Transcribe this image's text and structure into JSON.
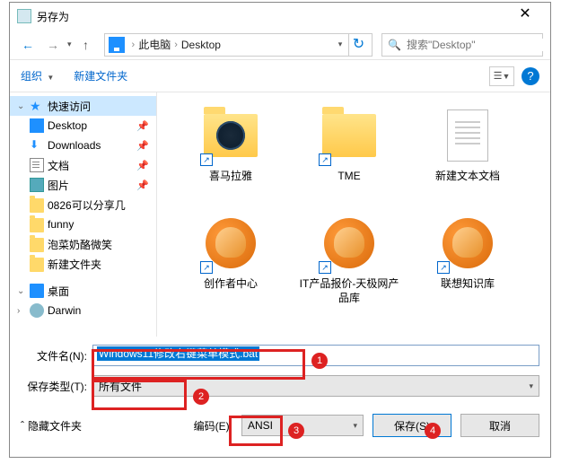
{
  "window": {
    "title": "另存为"
  },
  "breadcrumbs": {
    "item1": "此电脑",
    "item2": "Desktop"
  },
  "search": {
    "placeholder": "搜索\"Desktop\""
  },
  "toolbar": {
    "organize": "组织",
    "newfolder": "新建文件夹"
  },
  "sidebar": {
    "quick": "快速访问",
    "desktop": "Desktop",
    "downloads": "Downloads",
    "documents": "文档",
    "pictures": "图片",
    "f1": "0826可以分享几",
    "f2": "funny",
    "f3": "泡菜奶酪微笑",
    "f4": "新建文件夹",
    "desk2": "桌面",
    "user": "Darwin"
  },
  "items": {
    "i1": "喜马拉雅",
    "i2": "TME",
    "i3": "新建文本文档",
    "i4": "创作者中心",
    "i5": "IT产品报价-天极网产品库",
    "i6": "联想知识库"
  },
  "labels": {
    "filename": "文件名(N):",
    "filetype": "保存类型(T):",
    "encoding": "编码(E):",
    "hide": "隐藏文件夹"
  },
  "values": {
    "filename": "Windows11修改右键菜单模式.bat",
    "filetype": "所有文件",
    "encoding": "ANSI"
  },
  "buttons": {
    "save": "保存(S)",
    "cancel": "取消"
  },
  "annotations": {
    "a1": "1",
    "a2": "2",
    "a3": "3",
    "a4": "4"
  }
}
